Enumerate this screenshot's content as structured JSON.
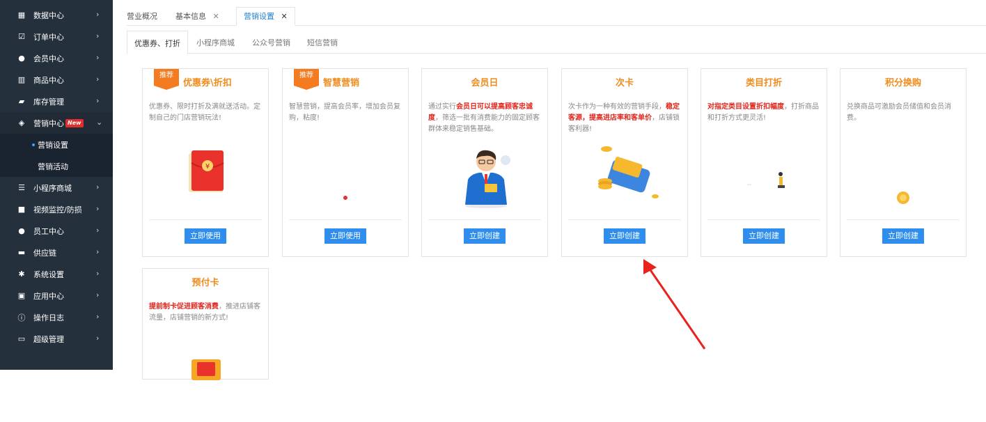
{
  "sidebar": {
    "items": [
      {
        "label": "数据中心",
        "icon": "chart-icon",
        "glyph": "▦",
        "chev": "›"
      },
      {
        "label": "订单中心",
        "icon": "checklist-icon",
        "glyph": "☑",
        "chev": "›"
      },
      {
        "label": "会员中心",
        "icon": "user-icon",
        "glyph": "●",
        "chev": "›"
      },
      {
        "label": "商品中心",
        "icon": "books-icon",
        "glyph": "▥",
        "chev": "›"
      },
      {
        "label": "库存管理",
        "icon": "book-icon",
        "glyph": "▰",
        "chev": "›"
      },
      {
        "label": "营销中心",
        "icon": "tag-icon",
        "glyph": "◈",
        "chev": "⌄",
        "badge": "New"
      },
      {
        "label": "小程序商城",
        "icon": "shop-icon",
        "glyph": "☰",
        "chev": "›"
      },
      {
        "label": "视频监控/防损",
        "icon": "video-icon",
        "glyph": "■",
        "chev": "›"
      },
      {
        "label": "员工中心",
        "icon": "staff-icon",
        "glyph": "●",
        "chev": "›"
      },
      {
        "label": "供应链",
        "icon": "truck-icon",
        "glyph": "▬",
        "chev": "›"
      },
      {
        "label": "系统设置",
        "icon": "gear-icon",
        "glyph": "✱",
        "chev": "›"
      },
      {
        "label": "应用中心",
        "icon": "briefcase-icon",
        "glyph": "▣",
        "chev": "›"
      },
      {
        "label": "操作日志",
        "icon": "info-icon",
        "glyph": "ⓘ",
        "chev": "›"
      },
      {
        "label": "超级管理",
        "icon": "card-icon",
        "glyph": "▭",
        "chev": "›"
      }
    ],
    "sub": [
      {
        "label": "营销设置"
      },
      {
        "label": "营销活动"
      }
    ]
  },
  "tabs": [
    {
      "label": "营业概况",
      "close": ""
    },
    {
      "label": "基本信息",
      "close": "✕"
    },
    {
      "label": "营销设置",
      "close": "✕"
    }
  ],
  "subtabs": [
    {
      "label": "优惠券、打折"
    },
    {
      "label": "小程序商城"
    },
    {
      "label": "公众号营销"
    },
    {
      "label": "短信营销"
    }
  ],
  "cards": [
    {
      "title": "优惠券\\折扣",
      "ribbon": "推荐",
      "desc_parts": [
        "优惠券、限时打折及满就送活动。定制自己的门店营销玩法!"
      ],
      "button": "立即使用"
    },
    {
      "title": "智慧营销",
      "ribbon": "推荐",
      "desc_parts": [
        "智慧营销，提高会员率，增加会员复购，粘度!"
      ],
      "button": "立即使用"
    },
    {
      "title": "会员日",
      "desc_parts": [
        "通过实行",
        "会员日可以提高顾客忠诚度",
        "，筛选一批有消费能力的固定顾客群体来稳定销售基础。"
      ],
      "button": "立即创建"
    },
    {
      "title": "次卡",
      "desc_parts": [
        "次卡作为一种有效的营销手段，",
        "稳定客源，提高进店率和客单价",
        "，店铺锁客利器!"
      ],
      "button": "立即创建"
    },
    {
      "title": "类目打折",
      "desc_parts": [
        "",
        "对指定类目设置折扣幅度",
        "，打折商品和打折方式更灵活!"
      ],
      "button": "立即创建"
    },
    {
      "title": "积分换购",
      "desc_parts": [
        "兑换商品可激励会员储值和会员消费。"
      ],
      "button": "立即创建"
    },
    {
      "title": "预付卡",
      "desc_parts": [
        "",
        "提前制卡促进顾客消费",
        "，推进店铺客流量，店铺营销的新方式!"
      ],
      "button": ""
    }
  ],
  "colors": {
    "sidebar_bg": "#24303c",
    "accent_blue": "#2e8ded",
    "title_orange": "#f08c1e",
    "highlight_red": "#e2251b",
    "annotation_arrow": "#e8231e"
  }
}
